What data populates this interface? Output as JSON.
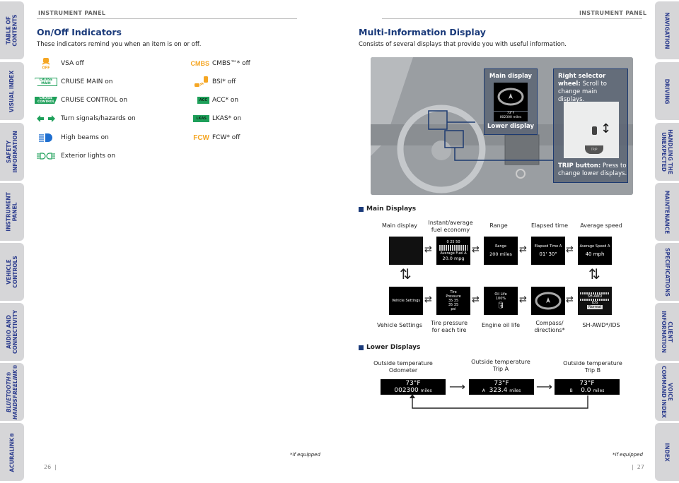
{
  "left_tabs": [
    {
      "label": "TABLE OF\nCONTENTS"
    },
    {
      "label": "VISUAL INDEX"
    },
    {
      "label": "SAFETY\nINFORMATION"
    },
    {
      "label": "INSTRUMENT\nPANEL"
    },
    {
      "label": "VEHICLE\nCONTROLS"
    },
    {
      "label": "AUDIO AND\nCONNECTIVITY"
    },
    {
      "label": "BLUETOOTH®\nHANDSFREELINK®"
    },
    {
      "label": "ACURALINK®"
    }
  ],
  "right_tabs": [
    {
      "label": "NAVIGATION"
    },
    {
      "label": "DRIVING"
    },
    {
      "label": "HANDLING THE\nUNEXPECTED"
    },
    {
      "label": "MAINTENANCE"
    },
    {
      "label": "SPECIFICATIONS"
    },
    {
      "label": "CLIENT\nINFORMATION"
    },
    {
      "label": "VOICE\nCOMMAND INDEX"
    },
    {
      "label": "INDEX"
    }
  ],
  "left_page": {
    "running_head": "INSTRUMENT PANEL",
    "title": "On/Off Indicators",
    "intro": "These indicators remind you when an item is on or off.",
    "indicators_left": [
      {
        "icon": "vsa-off-icon",
        "label": "VSA off",
        "badge": "OFF"
      },
      {
        "icon": "cruise-main-icon",
        "label": "CRUISE MAIN on",
        "badge": "CRUISE\nMAIN"
      },
      {
        "icon": "cruise-control-icon",
        "label": "CRUISE CONTROL on",
        "badge": "CRUISE\nCONTROL"
      },
      {
        "icon": "turn-signals-icon",
        "label": "Turn signals/hazards on"
      },
      {
        "icon": "high-beams-icon",
        "label": "High beams on"
      },
      {
        "icon": "exterior-lights-icon",
        "label": "Exterior lights on"
      }
    ],
    "indicators_right": [
      {
        "icon": "cmbs-icon",
        "label": "CMBS™* off",
        "badge": "CMBS"
      },
      {
        "icon": "bsi-icon",
        "label": "BSI* off"
      },
      {
        "icon": "acc-icon",
        "label": "ACC* on",
        "badge": "ACC"
      },
      {
        "icon": "lkas-icon",
        "label": "LKAS* on",
        "badge": "LKAS"
      },
      {
        "icon": "fcw-icon",
        "label": "FCW* off",
        "badge": "FCW"
      }
    ],
    "footnote": "*if equipped",
    "page_number": "26",
    "colors": {
      "amber": "#f5a623",
      "green": "#1ea05a",
      "blue": "#1f6fd0",
      "title": "#1a3a7a"
    }
  },
  "right_page": {
    "running_head": "INSTRUMENT PANEL",
    "title": "Multi-Information Display",
    "intro": "Consists of several displays that provide you with useful information.",
    "photo": {
      "main_display_label": "Main display",
      "lower_display_label": "Lower display",
      "lower_screen_temp": "73°F",
      "lower_screen_odo": "002300 miles",
      "selector_title": "Right selector wheel:",
      "selector_text": "Scroll to change main displays.",
      "trip_title": "TRIP button:",
      "trip_text": "Press to change lower displays.",
      "trip_button_label": "TRIP"
    },
    "main_displays": {
      "heading": "Main Displays",
      "top_row": [
        {
          "caption": "Main display",
          "screen": []
        },
        {
          "caption": "Instant/average\nfuel economy",
          "screen": [
            "0  25  50",
            "Average Fuel A",
            "20.0 mpg"
          ]
        },
        {
          "caption": "Range",
          "screen": [
            "Range",
            "200 miles"
          ]
        },
        {
          "caption": "Elapsed time",
          "screen": [
            "Elapsed Time A",
            "01' 30\""
          ]
        },
        {
          "caption": "Average speed",
          "screen": [
            "Average Speed A",
            "40 mph"
          ]
        }
      ],
      "bottom_row": [
        {
          "caption": "Vehicle Settings",
          "screen": [
            "Vehicle Settings"
          ]
        },
        {
          "caption": "Tire pressure\nfor each tire",
          "screen": [
            "Tire",
            "Pressure",
            "35  35",
            "35  35",
            "psi"
          ]
        },
        {
          "caption": "Engine oil life",
          "screen": [
            "Oil Life",
            "100%"
          ]
        },
        {
          "caption": "Compass/\ndirections*",
          "screen": [
            "N"
          ]
        },
        {
          "caption": "SH-AWD*/IDS",
          "screen": [
            "SH-AWD",
            "IDS",
            "Normal"
          ]
        }
      ]
    },
    "lower_displays": {
      "heading": "Lower Displays",
      "items": [
        {
          "caption": "Outside temperature\nOdometer",
          "temp": "73°F",
          "prefix": "",
          "value": "002300",
          "unit": "miles"
        },
        {
          "caption": "Outside temperature\nTrip A",
          "temp": "73°F",
          "prefix": "A",
          "value": "323.4",
          "unit": "miles"
        },
        {
          "caption": "Outside temperature\nTrip B",
          "temp": "73°F",
          "prefix": "B",
          "value": "0.0",
          "unit": "miles"
        }
      ]
    },
    "footnote": "*if equipped",
    "page_number": "27"
  }
}
